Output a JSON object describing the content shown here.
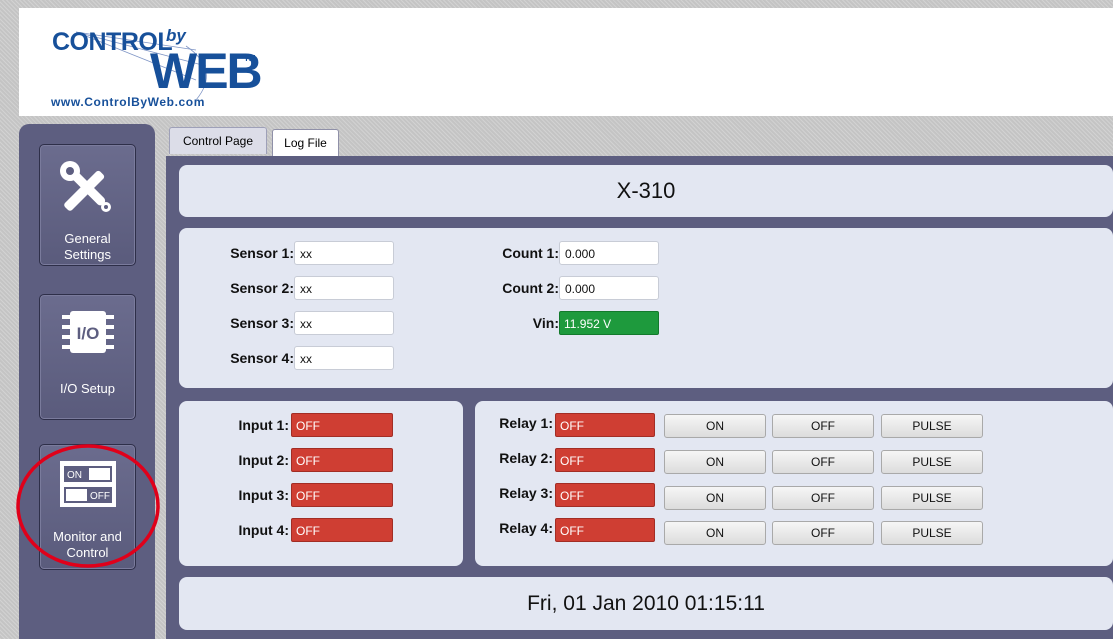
{
  "logo": {
    "brand": "CONTROL",
    "by": "by",
    "web": "WEB",
    "tm": "TM",
    "url": "www.ControlByWeb.com"
  },
  "sidebar": {
    "items": [
      {
        "label": "General Settings",
        "icon": "tools-icon"
      },
      {
        "label": "I/O Setup",
        "icon": "io-chip-icon"
      },
      {
        "label": "Monitor and Control",
        "icon": "switch-toggle-icon"
      }
    ],
    "switch_icon": {
      "on": "ON",
      "off": "OFF"
    },
    "io_icon_text": "I/O"
  },
  "tabs": [
    {
      "label": "Control Page",
      "active": true
    },
    {
      "label": "Log File",
      "active": false
    }
  ],
  "device": {
    "title": "X-310"
  },
  "sensors": [
    {
      "label": "Sensor 1:",
      "value": "xx"
    },
    {
      "label": "Sensor 2:",
      "value": "xx"
    },
    {
      "label": "Sensor 3:",
      "value": "xx"
    },
    {
      "label": "Sensor 4:",
      "value": "xx"
    }
  ],
  "counters": [
    {
      "label": "Count 1:",
      "value": "0.000"
    },
    {
      "label": "Count 2:",
      "value": "0.000"
    }
  ],
  "vin": {
    "label": "Vin:",
    "value": "11.952 V"
  },
  "inputs": [
    {
      "label": "Input 1:",
      "state": "OFF"
    },
    {
      "label": "Input 2:",
      "state": "OFF"
    },
    {
      "label": "Input 3:",
      "state": "OFF"
    },
    {
      "label": "Input 4:",
      "state": "OFF"
    }
  ],
  "relays": [
    {
      "label": "Relay 1:",
      "state": "OFF"
    },
    {
      "label": "Relay 2:",
      "state": "OFF"
    },
    {
      "label": "Relay 3:",
      "state": "OFF"
    },
    {
      "label": "Relay 4:",
      "state": "OFF"
    }
  ],
  "relay_buttons": {
    "on": "ON",
    "off": "OFF",
    "pulse": "PULSE"
  },
  "datetime": "Fri, 01 Jan 2010 01:15:11",
  "colors": {
    "off_state": "#cf3e33",
    "vin_ok": "#1e9a3d",
    "brand_blue": "#17509a",
    "frame": "#5d5e80",
    "panel": "#e3e7f2",
    "annotation_circle": "#e0001a"
  }
}
